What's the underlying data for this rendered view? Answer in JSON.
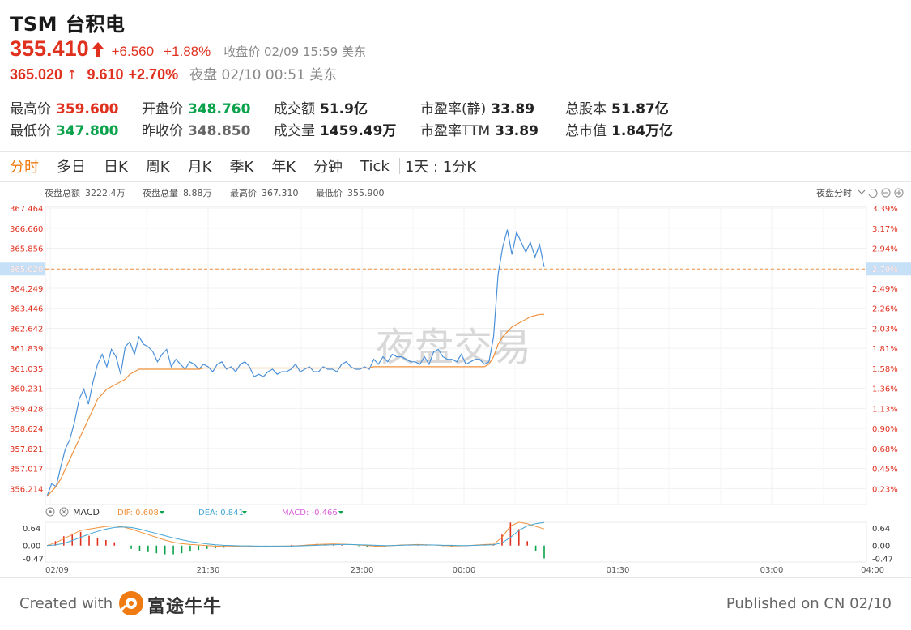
{
  "header": {
    "ticker": "TSM",
    "name": "台积电",
    "price": "355.410",
    "change": "+6.560",
    "change_pct": "+1.88%",
    "close_note": "收盘价 02/09 15:59 美东",
    "night_price": "365.020",
    "night_arrow": "↑",
    "night_change": "9.610",
    "night_change_pct": "+2.70%",
    "night_note": "夜盘 02/10 00:51 美东"
  },
  "stats": {
    "high_label": "最高价",
    "high_value": "359.600",
    "low_label": "最低价",
    "low_value": "347.800",
    "open_label": "开盘价",
    "open_value": "348.760",
    "prev_label": "昨收价",
    "prev_value": "348.850",
    "turnover_label": "成交额",
    "turnover_value": "51.9亿",
    "volume_label": "成交量",
    "volume_value": "1459.49万",
    "pe_static_label": "市盈率(静)",
    "pe_static_value": "33.89",
    "pe_ttm_label": "市盈率TTM",
    "pe_ttm_value": "33.89",
    "shares_label": "总股本",
    "shares_value": "51.87亿",
    "mktcap_label": "总市值",
    "mktcap_value": "1.84万亿"
  },
  "tabs": [
    "分时",
    "多日",
    "日K",
    "周K",
    "月K",
    "季K",
    "年K",
    "分钟",
    "Tick"
  ],
  "active_tab": "分时",
  "range_selector": "1天 : 1分K",
  "chart_info": {
    "night_turnover_label": "夜盘总额",
    "night_turnover_value": "3222.4万",
    "night_volume_label": "夜盘总量",
    "night_volume_value": "8.88万",
    "high_label": "最高价",
    "high_value": "367.310",
    "low_label": "最低价",
    "low_value": "355.900",
    "mode_label": "夜盘分时",
    "watermark": "夜盘交易",
    "macd_label": "MACD",
    "dif_label": "DIF: 0.608",
    "dea_label": "DEA: 0.841",
    "macd_value_label": "MACD: -0.466"
  },
  "colors": {
    "up": "#e0301e",
    "down": "#0aa24a",
    "accent": "#f07b12",
    "price_line": "#4a90d9",
    "avg_line": "#f0913c",
    "dif_line": "#f0913c",
    "dea_line": "#43a5d6",
    "macd_label": "#d85fd8"
  },
  "chart_data": {
    "type": "line",
    "x_ticks": [
      "02/09",
      "21:30",
      "23:00",
      "00:00",
      "01:30",
      "03:00",
      "04:00"
    ],
    "y_left_ticks": [
      "367.464",
      "366.660",
      "365.856",
      "365.020",
      "364.249",
      "363.446",
      "362.642",
      "361.839",
      "361.035",
      "360.231",
      "359.428",
      "358.624",
      "357.821",
      "357.017",
      "356.214"
    ],
    "y_right_ticks": [
      "3.39%",
      "3.17%",
      "2.94%",
      "2.70%",
      "2.49%",
      "2.26%",
      "2.03%",
      "1.81%",
      "1.58%",
      "1.36%",
      "1.13%",
      "0.90%",
      "0.68%",
      "0.45%",
      "0.23%"
    ],
    "ylim": [
      355.9,
      367.464
    ],
    "reference_price": 365.02,
    "reference_label": "365.020",
    "reference_pct": "2.70%",
    "series": [
      {
        "name": "price",
        "values": [
          355.9,
          356.4,
          356.3,
          357.1,
          357.8,
          358.2,
          358.9,
          359.8,
          360.2,
          359.6,
          360.5,
          361.2,
          361.6,
          361.1,
          361.8,
          361.5,
          360.8,
          361.9,
          362.1,
          361.6,
          362.3,
          362.0,
          361.9,
          361.7,
          361.3,
          361.6,
          361.8,
          361.1,
          361.4,
          361.2,
          361.0,
          361.3,
          361.2,
          361.0,
          361.2,
          361.1,
          360.9,
          361.2,
          361.3,
          361.0,
          361.1,
          360.9,
          361.2,
          361.3,
          361.1,
          360.7,
          360.8,
          360.7,
          360.9,
          361.0,
          360.8,
          360.9,
          360.9,
          361.0,
          361.2,
          360.9,
          361.0,
          361.1,
          360.9,
          360.9,
          361.1,
          361.0,
          361.0,
          360.9,
          361.2,
          361.3,
          361.1,
          361.0,
          361.0,
          361.1,
          361.0,
          361.4,
          361.2,
          361.5,
          361.3,
          361.6,
          361.5,
          361.5,
          361.4,
          361.3,
          361.3,
          361.2,
          361.5,
          361.2,
          361.7,
          361.8,
          361.5,
          361.4,
          361.4,
          361.3,
          361.6,
          361.2,
          361.3,
          361.4,
          361.4,
          361.2,
          361.3,
          362.3,
          364.8,
          365.9,
          366.6,
          365.6,
          366.5,
          366.1,
          365.7,
          366.1,
          365.5,
          366.0,
          365.1
        ],
        "color": "#4a90d9"
      },
      {
        "name": "avg",
        "values": [
          355.9,
          356.1,
          356.3,
          356.6,
          357.0,
          357.4,
          357.8,
          358.2,
          358.6,
          359.0,
          359.4,
          359.8,
          360.0,
          360.2,
          360.3,
          360.4,
          360.5,
          360.6,
          360.8,
          360.9,
          361.0,
          361.0,
          361.0,
          361.0,
          361.0,
          361.0,
          361.0,
          361.0,
          361.0,
          361.0,
          361.0,
          361.0,
          361.0,
          361.0,
          361.05,
          361.05,
          361.05,
          361.05,
          361.05,
          361.05,
          361.05,
          361.05,
          361.05,
          361.05,
          361.05,
          361.05,
          361.05,
          361.05,
          361.05,
          361.05,
          361.05,
          361.05,
          361.05,
          361.05,
          361.05,
          361.05,
          361.05,
          361.05,
          361.05,
          361.05,
          361.05,
          361.05,
          361.05,
          361.05,
          361.05,
          361.05,
          361.05,
          361.05,
          361.05,
          361.05,
          361.05,
          361.1,
          361.1,
          361.1,
          361.1,
          361.1,
          361.1,
          361.1,
          361.1,
          361.1,
          361.1,
          361.1,
          361.1,
          361.1,
          361.1,
          361.1,
          361.1,
          361.1,
          361.1,
          361.1,
          361.1,
          361.1,
          361.1,
          361.1,
          361.1,
          361.1,
          361.2,
          361.5,
          362.0,
          362.3,
          362.5,
          362.7,
          362.8,
          362.9,
          363.0,
          363.1,
          363.15,
          363.2,
          363.2
        ],
        "color": "#f0913c"
      }
    ],
    "macd_ticks": [
      "0.64",
      "0.00",
      "-0.47"
    ],
    "macd_ticks_right": [
      "0.64",
      "0.00",
      "-0.47"
    ],
    "macd_ylim": [
      -0.6,
      0.85
    ],
    "macd": {
      "dif": [
        0.0,
        0.1,
        0.25,
        0.4,
        0.55,
        0.6,
        0.65,
        0.7,
        0.72,
        0.68,
        0.6,
        0.5,
        0.4,
        0.3,
        0.2,
        0.12,
        0.07,
        0.04,
        0.02,
        0.0,
        -0.02,
        -0.03,
        -0.03,
        -0.02,
        -0.02,
        -0.03,
        -0.03,
        -0.02,
        -0.02,
        -0.01,
        0.0,
        0.02,
        0.04,
        0.05,
        0.06,
        0.05,
        0.04,
        0.02,
        0.0,
        -0.02,
        -0.02,
        0.0,
        0.02,
        0.03,
        0.04,
        0.03,
        0.02,
        0.0,
        -0.01,
        -0.01,
        0.0,
        0.02,
        0.04,
        0.05,
        0.3,
        0.72,
        0.85,
        0.8,
        0.7,
        0.608
      ],
      "dea": [
        0.0,
        0.02,
        0.08,
        0.18,
        0.3,
        0.42,
        0.52,
        0.6,
        0.66,
        0.68,
        0.66,
        0.6,
        0.52,
        0.44,
        0.36,
        0.28,
        0.21,
        0.15,
        0.1,
        0.06,
        0.03,
        0.01,
        0.0,
        -0.01,
        -0.01,
        -0.02,
        -0.02,
        -0.02,
        -0.02,
        -0.02,
        -0.01,
        0.0,
        0.01,
        0.02,
        0.03,
        0.04,
        0.04,
        0.03,
        0.02,
        0.01,
        0.0,
        0.0,
        0.01,
        0.02,
        0.02,
        0.02,
        0.02,
        0.01,
        0.01,
        0.0,
        0.0,
        0.01,
        0.02,
        0.03,
        0.1,
        0.3,
        0.55,
        0.72,
        0.8,
        0.841
      ],
      "hist": [
        0.0,
        0.16,
        0.34,
        0.44,
        0.5,
        0.36,
        0.26,
        0.2,
        0.12,
        0.0,
        -0.12,
        -0.2,
        -0.24,
        -0.28,
        -0.32,
        -0.32,
        -0.28,
        -0.22,
        -0.16,
        -0.12,
        -0.1,
        -0.08,
        -0.06,
        -0.02,
        -0.02,
        -0.02,
        -0.02,
        0.0,
        0.0,
        0.02,
        0.02,
        0.04,
        0.06,
        0.06,
        0.06,
        0.02,
        0.0,
        -0.02,
        -0.04,
        -0.06,
        -0.04,
        0.0,
        0.02,
        0.02,
        0.04,
        0.02,
        0.0,
        -0.02,
        -0.04,
        -0.02,
        0.0,
        0.02,
        0.04,
        0.04,
        0.4,
        0.84,
        0.6,
        0.16,
        -0.2,
        -0.466
      ]
    }
  },
  "footer": {
    "created_with": "Created with",
    "brand": "富途牛牛",
    "published": "Published on CN 02/10"
  }
}
